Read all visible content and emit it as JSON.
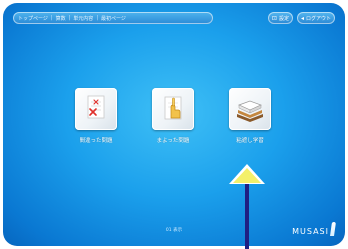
{
  "topbar": {
    "breadcrumbs": [
      {
        "label": "トップページ"
      },
      {
        "label": "算数"
      },
      {
        "label": "単元内容"
      },
      {
        "label": "最初ページ"
      }
    ],
    "buttons": [
      {
        "icon": "help-icon",
        "label": "設定"
      },
      {
        "icon": "logout-icon",
        "label": "ログアウト"
      }
    ]
  },
  "menu": {
    "tiles": [
      {
        "name": "menu-tile-mistakes",
        "icon": "error-sheet-icon",
        "label": "間違った問題"
      },
      {
        "name": "menu-tile-unsure",
        "icon": "pointing-hand-icon",
        "label": "まよった問題"
      },
      {
        "name": "menu-tile-review",
        "icon": "books-icon",
        "label": "粘遮し学習"
      }
    ]
  },
  "footer": {
    "page_indicator": "01 表示"
  },
  "logo": {
    "text": "MUSASI"
  },
  "colors": {
    "background": "#1ba0ec",
    "pointer_fill": "#f3f06a",
    "pointer_shaft": "#1f1f82"
  }
}
